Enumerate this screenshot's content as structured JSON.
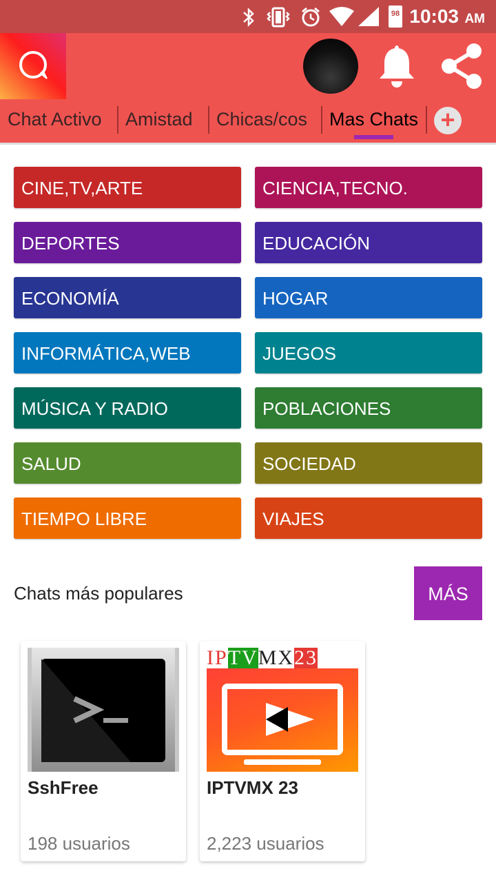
{
  "status_bar": {
    "time": "10:03",
    "ampm": "AM",
    "battery": "98",
    "icons": [
      "bluetooth-icon",
      "vibrate-icon",
      "alarm-icon",
      "wifi-icon",
      "signal-icon",
      "battery-icon"
    ]
  },
  "header": {
    "logo_icon": "chat-bubble-icon",
    "bell_icon": "bell-icon",
    "share_icon": "share-icon"
  },
  "tabs": [
    {
      "label": "Chat Activo"
    },
    {
      "label": "Amistad"
    },
    {
      "label": "Chicas/cos"
    },
    {
      "label": "Mas Chats",
      "active": true
    }
  ],
  "add_tab_label": "+",
  "categories": [
    {
      "label": "CINE,TV,ARTE",
      "color": "#c62828"
    },
    {
      "label": "CIENCIA,TECNO.",
      "color": "#ad1457"
    },
    {
      "label": "DEPORTES",
      "color": "#6a1b9a"
    },
    {
      "label": "EDUCACIÓN",
      "color": "#4527a0"
    },
    {
      "label": "ECONOMÍA",
      "color": "#283593"
    },
    {
      "label": "HOGAR",
      "color": "#1565c0"
    },
    {
      "label": "INFORMÁTICA,WEB",
      "color": "#0277bd"
    },
    {
      "label": "JUEGOS",
      "color": "#00838f"
    },
    {
      "label": "MÚSICA Y RADIO",
      "color": "#00695c"
    },
    {
      "label": "POBLACIONES",
      "color": "#2e7d32"
    },
    {
      "label": "SALUD",
      "color": "#558b2f"
    },
    {
      "label": "SOCIEDAD",
      "color": "#827717"
    },
    {
      "label": "TIEMPO LIBRE",
      "color": "#ef6c00"
    },
    {
      "label": "VIAJES",
      "color": "#d84315"
    }
  ],
  "popular": {
    "title": "Chats más populares",
    "more_label": "MÁS",
    "cards": [
      {
        "title": "SshFree",
        "users": "198 usuarios",
        "thumb_icon": "terminal-icon"
      },
      {
        "title": "IPTVMX 23",
        "users": "2,223 usuarios",
        "thumb_icon": "tv-play-icon",
        "thumb_text": [
          "I",
          "P",
          "T",
          "V",
          "M",
          "X",
          "2",
          "3"
        ]
      }
    ]
  }
}
